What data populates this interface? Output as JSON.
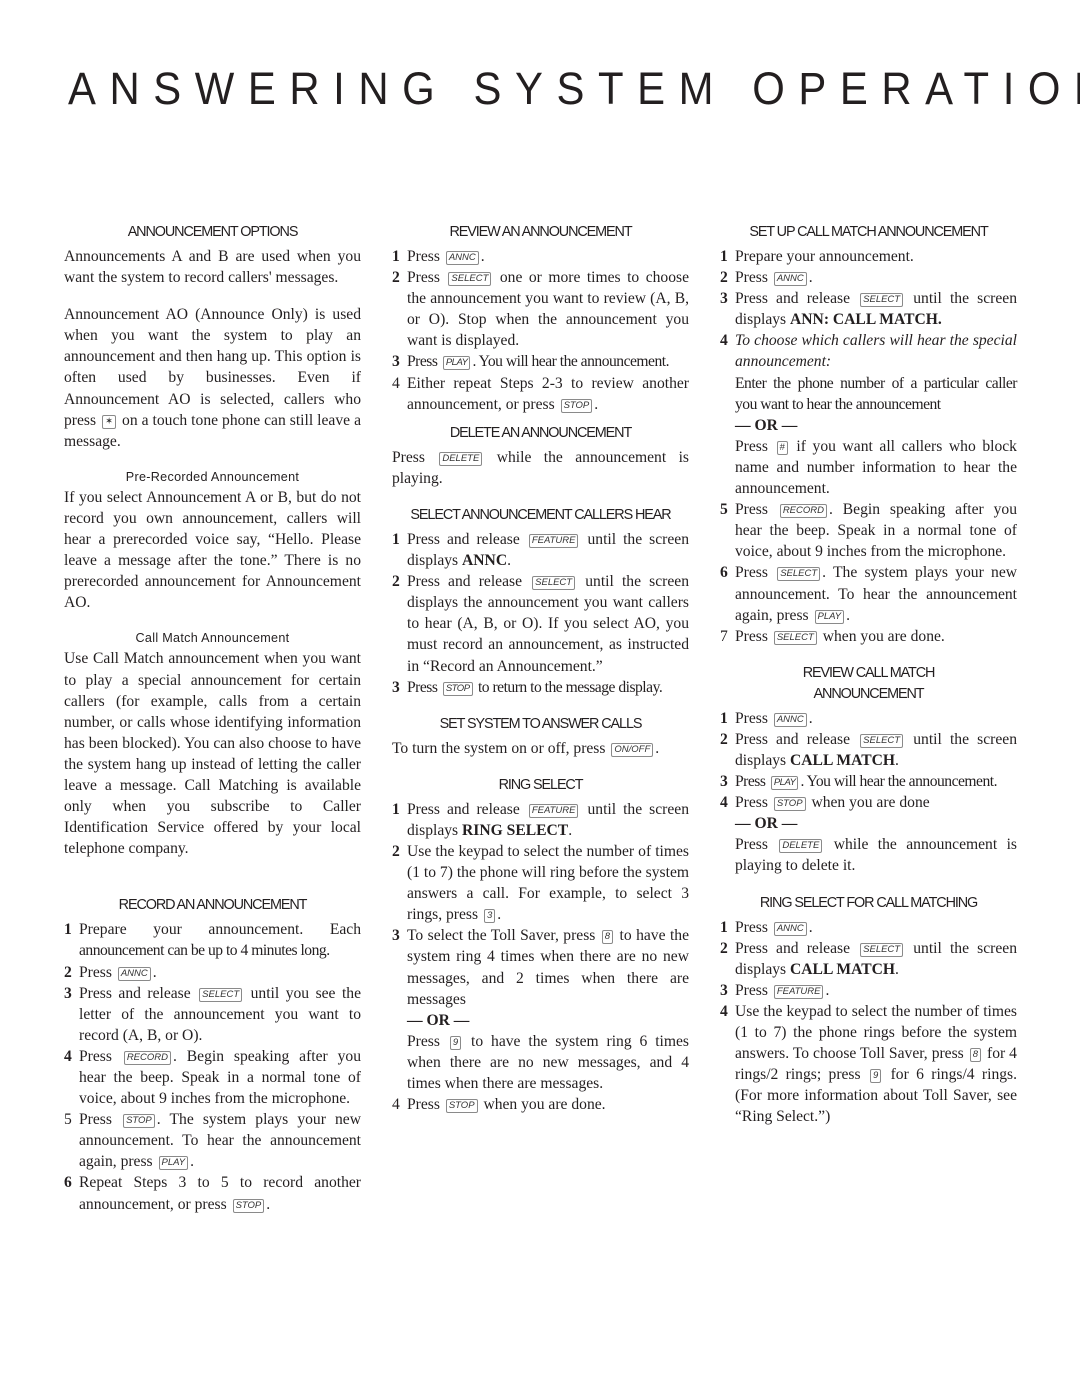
{
  "title": "ANSWERING SYSTEM OPERATION",
  "keys": {
    "annc": "ANNC",
    "select": "SELECT",
    "play": "PLAY",
    "stop": "STOP",
    "record": "RECORD",
    "delete": "DELETE",
    "feature": "FEATURE",
    "onoff": "ON/OFF",
    "star": "✶",
    "hash": "#",
    "three": "3",
    "eight": "8",
    "nine": "9"
  },
  "or_label": "— OR —",
  "announcement_options": {
    "heading": "ANNOUNCEMENT OPTIONS",
    "para1": "Announcements A and B are used when you want the system to record callers' messages.",
    "para2_a": "Announcement AO (Announce Only) is used when you want the system to play an announcement and then hang up.  This option is often used by businesses.  Even if Announcement AO is selected, callers who press",
    "para2_b": "on a touch tone phone can still leave a message.",
    "prerecorded_heading": "Pre-Recorded Announcement",
    "prerecorded_text": "If you select Announcement A or B, but do not record you own announcement, callers will hear a prerecorded voice say, “Hello.  Please leave a message after the tone.”  There is no prerecorded announcement for Announcement AO.",
    "callmatch_heading": "Call Match Announcement",
    "callmatch_text": "Use Call Match announcement when you want to play a special announcement for certain callers (for example, calls from a certain number, or calls whose identifying information has been blocked).  You can also choose to have the system hang up instead of letting the caller leave a message. Call Matching is available only when you subscribe to Caller Identification Service offered by your local telephone company."
  },
  "record_announcement": {
    "heading": "RECORD AN ANNOUNCEMENT",
    "steps": [
      {
        "num": "1",
        "a": "Prepare your announcement.  Each",
        "b": "announcement can be up to 4 minutes long."
      },
      {
        "num": "2",
        "a": "Press",
        "b": "."
      },
      {
        "num": "3",
        "a": "Press and release",
        "b": "until  you see the letter of the announcement you want to record (A, B, or O)."
      },
      {
        "num": "4",
        "a": "Press",
        "b": ".  Begin speaking after you hear the beep.  Speak in a normal tone of voice, about 9 inches from the microphone."
      },
      {
        "num": "5",
        "a": "Press",
        "b": ".  The system plays your new announcement.  To hear the announcement again, press",
        "c": "."
      },
      {
        "num": "6",
        "a": "Repeat Steps 3 to 5 to record another announcement, or press",
        "b": "."
      }
    ]
  },
  "review_announcement": {
    "heading": "REVIEW AN ANNOUNCEMENT",
    "steps": [
      {
        "num": "1",
        "a": "Press",
        "b": "."
      },
      {
        "num": "2",
        "a": "Press",
        "b": "one or more times to choose the announcement you want to review (A, B, or O).   Stop when the announcement you want is displayed."
      },
      {
        "num": "3",
        "a": "Press",
        "b": ". You will hear the announcement."
      },
      {
        "num": "4",
        "a": "Either repeat Steps 2-3 to review another announcement, or press",
        "b": "."
      }
    ]
  },
  "delete_announcement": {
    "heading": "DELETE AN ANNOUNCEMENT",
    "a": "Press",
    "b": "while the announcement is playing."
  },
  "select_callers_hear": {
    "heading": "SELECT ANNOUNCEMENT CALLERS HEAR",
    "steps": [
      {
        "num": "1",
        "a": "Press and release",
        "b": "until the screen displays",
        "bold": "ANNC",
        "c": "."
      },
      {
        "num": "2",
        "a": "Press and release",
        "b": "until the screen displays the announcement you want callers to hear (A, B, or O).  If you select AO, you must record an announcement, as instructed in “Record an Announcement.”"
      },
      {
        "num": "3",
        "a": "Press",
        "b": "to return to the message display."
      }
    ]
  },
  "set_system": {
    "heading": "SET SYSTEM TO ANSWER CALLS",
    "a": "To turn the system on or off, press",
    "b": "."
  },
  "ring_select": {
    "heading": "RING SELECT",
    "steps": [
      {
        "num": "1",
        "a": "Press and release",
        "b": "until the screen displays",
        "bold": "RING SELECT",
        "c": "."
      },
      {
        "num": "2",
        "a": "Use the keypad to select the number of times (1 to 7) the phone will ring before the system answers a call.  For example, to select 3 rings, press",
        "b": "."
      },
      {
        "num": "3",
        "a": "To select the Toll Saver, press",
        "b": "to have the system ring 4 times when there are no new messages, and 2 times when there are messages",
        "c": "Press",
        "d": "to have the system ring 6 times when there are no new messages, and 4 times when there are messages."
      },
      {
        "num": "4",
        "a": "Press",
        "b": "when you are done."
      }
    ]
  },
  "setup_call_match": {
    "heading": "SET UP CALL MATCH ANNOUNCEMENT",
    "steps": [
      {
        "num": "1",
        "a": "Prepare your announcement."
      },
      {
        "num": "2",
        "a": "Press",
        "b": "."
      },
      {
        "num": "3",
        "a": "Press and release",
        "b": "until the screen displays",
        "bold": "ANN: CALL MATCH."
      },
      {
        "num": "4",
        "italic": "To choose which callers will hear the special announcement:",
        "a": "Enter the phone number of a  particular caller you want to hear the announcement",
        "c": "Press",
        "d": "if you want all callers who block name and number information to hear the announcement."
      },
      {
        "num": "5",
        "a": "Press",
        "b": ".  Begin speaking after you hear the beep.  Speak in a normal tone of voice, about 9 inches from the microphone."
      },
      {
        "num": "6",
        "a": "Press",
        "b": ". The system plays your new announcement.  To hear the announcement again, press",
        "c": "."
      },
      {
        "num": "7",
        "a": "Press",
        "b": "when you are done."
      }
    ]
  },
  "review_call_match": {
    "heading_line1": "REVIEW CALL MATCH",
    "heading_line2": "ANNOUNCEMENT",
    "steps": [
      {
        "num": "1",
        "a": "Press",
        "b": "."
      },
      {
        "num": "2",
        "a": "Press and release",
        "b": "until the screen displays",
        "bold": "CALL MATCH",
        "c": "."
      },
      {
        "num": "3",
        "a": "Press",
        "b": ". You will hear the announcement."
      },
      {
        "num": "4",
        "a": "Press",
        "b": "when you are done",
        "c": "Press",
        "d": "while the announcement is playing to delete it."
      }
    ]
  },
  "ring_select_call_matching": {
    "heading": "RING SELECT FOR CALL MATCHING",
    "steps": [
      {
        "num": "1",
        "a": "Press",
        "b": "."
      },
      {
        "num": "2",
        "a": "Press and release",
        "b": "until the screen displays",
        "bold": "CALL MATCH",
        "c": "."
      },
      {
        "num": "3",
        "a": "Press",
        "b": "."
      },
      {
        "num": "4",
        "a": "Use the keypad to select the number of times (1 to 7) the phone rings before the system answers.  To choose Toll Saver, press",
        "b": "for 4 rings/2 rings; press",
        "c": "for 6 rings/4 rings.  (For more information about Toll Saver, see “Ring Select.”)"
      }
    ]
  }
}
